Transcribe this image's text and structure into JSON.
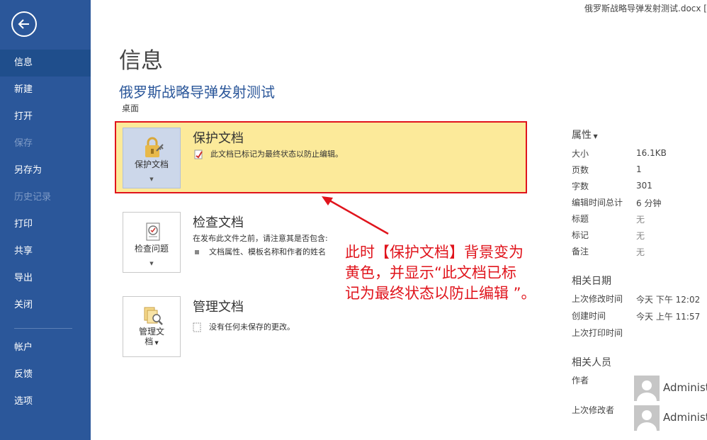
{
  "file": {
    "name": "俄罗斯战略导弹发射测试.docx ["
  },
  "sidebar": {
    "items": [
      {
        "label": "信息"
      },
      {
        "label": "新建"
      },
      {
        "label": "打开"
      },
      {
        "label": "保存"
      },
      {
        "label": "另存为"
      },
      {
        "label": "历史记录"
      },
      {
        "label": "打印"
      },
      {
        "label": "共享"
      },
      {
        "label": "导出"
      },
      {
        "label": "关闭"
      },
      {
        "label": "帐户"
      },
      {
        "label": "反馈"
      },
      {
        "label": "选项"
      }
    ]
  },
  "main": {
    "page_title": "信息",
    "doc_title": "俄罗斯战略导弹发射测试",
    "doc_location": "桌面",
    "sections": {
      "protect": {
        "button_label": "保护文档",
        "title": "保护文档",
        "desc": "此文档已标记为最终状态以防止编辑。",
        "highlight_bg": "#fcea9a",
        "border_color": "#e0141c"
      },
      "inspect": {
        "button_label": "检查问题",
        "title": "检查文档",
        "desc": "在发布此文件之前，请注意其是否包含:",
        "bullet": "文档属性、模板名称和作者的姓名"
      },
      "manage": {
        "button_label_1": "管理文",
        "button_label_2": "档",
        "title": "管理文档",
        "desc": "没有任何未保存的更改。"
      }
    },
    "annotation": {
      "line1": "此时【保护文档】背景变为",
      "line2": "黄色，并显示“此文档已标",
      "line3": "记为最终状态以防止编辑 ”。",
      "color": "#e0141c"
    }
  },
  "properties": {
    "header": "属性",
    "rows": [
      {
        "key": "大小",
        "value": "16.1KB"
      },
      {
        "key": "页数",
        "value": "1"
      },
      {
        "key": "字数",
        "value": "301"
      },
      {
        "key": "编辑时间总计",
        "value": "6 分钟"
      },
      {
        "key": "标题",
        "value": "无"
      },
      {
        "key": "标记",
        "value": "无"
      },
      {
        "key": "备注",
        "value": "无"
      }
    ],
    "dates_header": "相关日期",
    "dates": [
      {
        "key": "上次修改时间",
        "value": "今天 下午 12:02"
      },
      {
        "key": "创建时间",
        "value": "今天 上午 11:57"
      },
      {
        "key": "上次打印时间",
        "value": ""
      }
    ],
    "people_header": "相关人员",
    "people": [
      {
        "key": "作者",
        "name": "Administ"
      },
      {
        "key": "上次修改者",
        "name": "Administ"
      }
    ]
  },
  "colors": {
    "sidebar": "#2b579a",
    "accent": "#2b579a"
  }
}
